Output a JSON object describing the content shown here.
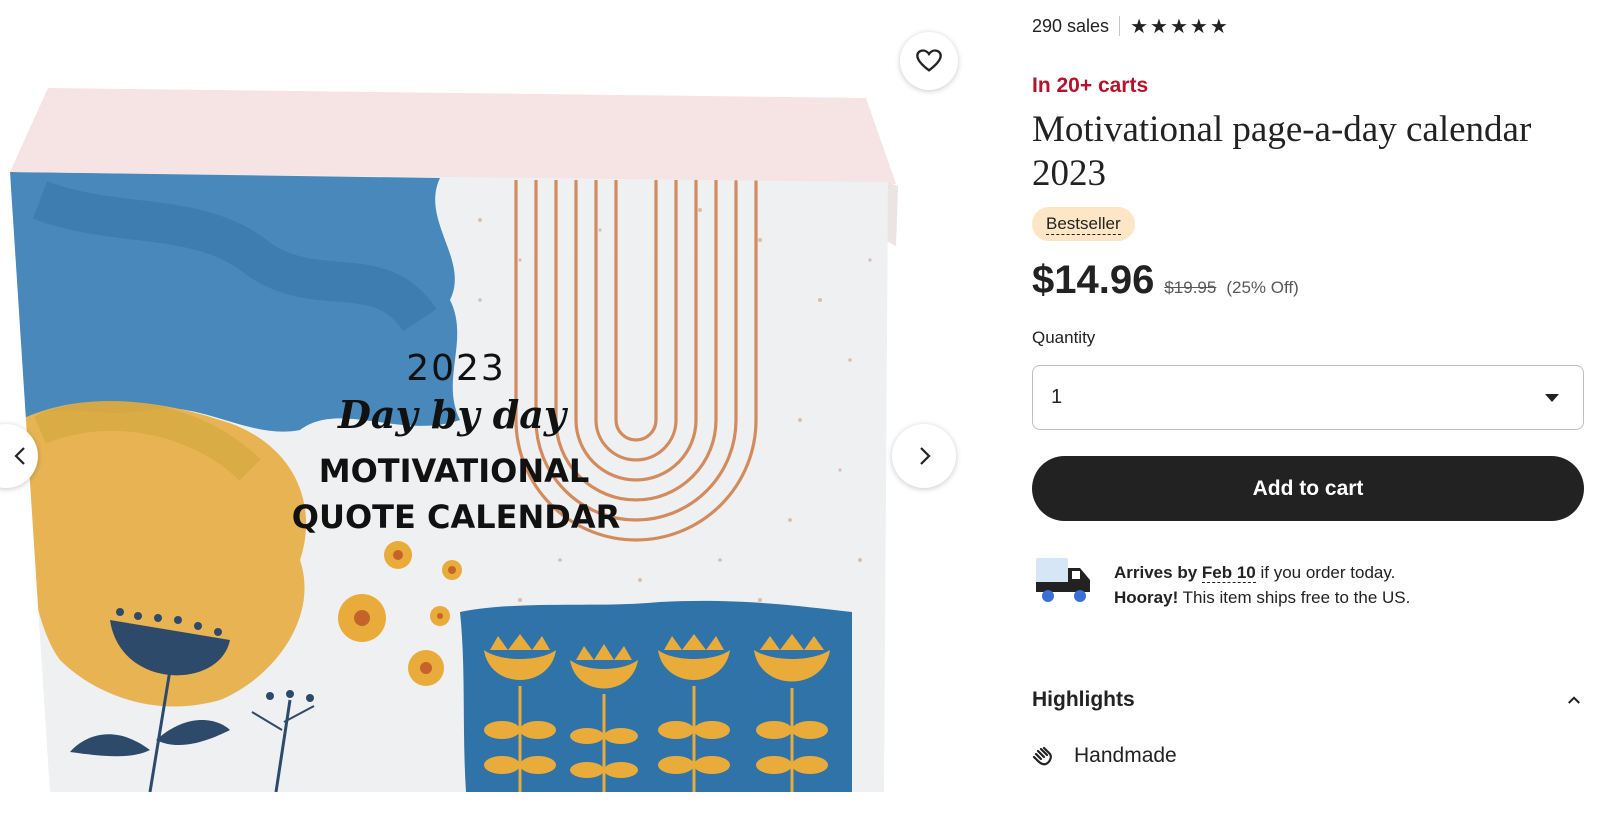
{
  "gallery": {
    "box_text": {
      "year": "2023",
      "subtitle": "Day by day",
      "line1": "MOTIVATIONAL",
      "line2": "QUOTE CALENDAR"
    },
    "icons": {
      "prev": "chevron-left-icon",
      "next": "chevron-right-icon",
      "favorite": "heart-icon"
    }
  },
  "buybox": {
    "sales": "290 sales",
    "rating_stars": 5,
    "cart_alert": "In 20+ carts",
    "title": "Motivational page-a-day calendar 2023",
    "badge": "Bestseller",
    "price": {
      "current": "$14.96",
      "original": "$19.95",
      "discount": "(25% Off)"
    },
    "quantity": {
      "label": "Quantity",
      "selected": "1"
    },
    "add_to_cart": "Add to cart",
    "shipping": {
      "arrives_prefix": "Arrives by",
      "arrival_date": "Feb 10",
      "arrives_suffix": "if you order today.",
      "hooray": "Hooray!",
      "free_text": "This item ships free to the US."
    },
    "highlights": {
      "title": "Highlights",
      "items": [
        {
          "label": "Handmade",
          "icon": "hand-icon"
        }
      ]
    }
  },
  "colors": {
    "alert_red": "#b3142d",
    "button_black": "#222222",
    "badge_bg": "#fce6c5"
  }
}
